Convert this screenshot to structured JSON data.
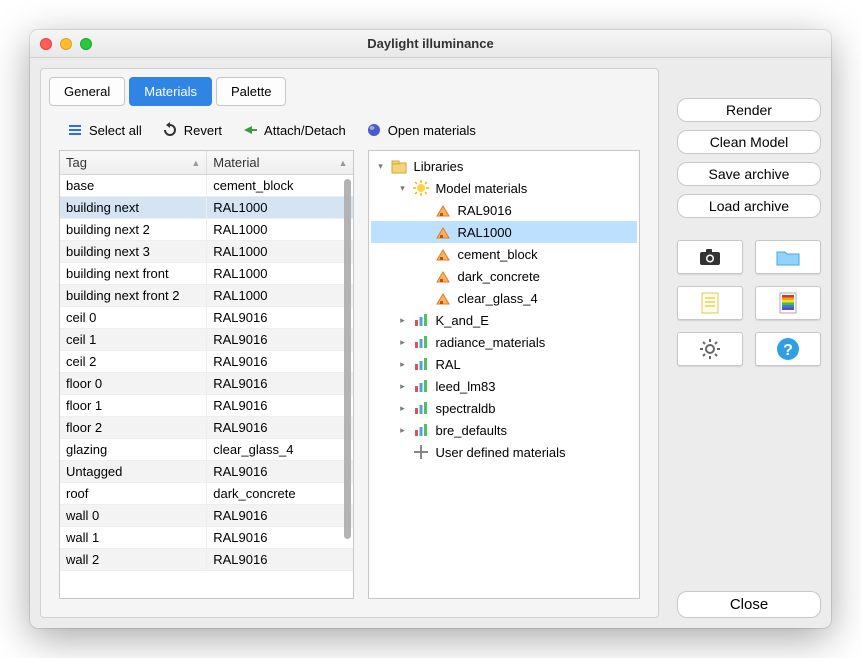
{
  "window": {
    "title": "Daylight illuminance"
  },
  "tabs": [
    {
      "label": "General",
      "active": false
    },
    {
      "label": "Materials",
      "active": true
    },
    {
      "label": "Palette",
      "active": false
    }
  ],
  "toolbar": {
    "select_all": "Select all",
    "revert": "Revert",
    "attach_detach": "Attach/Detach",
    "open_materials": "Open materials"
  },
  "table": {
    "headers": [
      "Tag",
      "Material"
    ],
    "rows": [
      {
        "tag": "base",
        "material": "cement_block"
      },
      {
        "tag": "building next",
        "material": "RAL1000",
        "selected": true
      },
      {
        "tag": "building next 2",
        "material": "RAL1000"
      },
      {
        "tag": "building next 3",
        "material": "RAL1000"
      },
      {
        "tag": "building next front",
        "material": "RAL1000"
      },
      {
        "tag": "building next front 2",
        "material": "RAL1000"
      },
      {
        "tag": "ceil 0",
        "material": "RAL9016"
      },
      {
        "tag": "ceil 1",
        "material": "RAL9016"
      },
      {
        "tag": "ceil 2",
        "material": "RAL9016"
      },
      {
        "tag": "floor 0",
        "material": "RAL9016"
      },
      {
        "tag": "floor 1",
        "material": "RAL9016"
      },
      {
        "tag": "floor 2",
        "material": "RAL9016"
      },
      {
        "tag": "glazing",
        "material": "clear_glass_4"
      },
      {
        "tag": "Untagged",
        "material": "RAL9016"
      },
      {
        "tag": "roof",
        "material": "dark_concrete"
      },
      {
        "tag": "wall 0",
        "material": "RAL9016"
      },
      {
        "tag": "wall 1",
        "material": "RAL9016"
      },
      {
        "tag": "wall 2",
        "material": "RAL9016"
      }
    ]
  },
  "tree": {
    "root": {
      "label": "Libraries",
      "expanded": true,
      "icon": "library"
    },
    "model_materials": {
      "label": "Model materials",
      "expanded": true,
      "icon": "model",
      "children": [
        {
          "label": "RAL9016",
          "icon": "material"
        },
        {
          "label": "RAL1000",
          "icon": "material",
          "selected": true
        },
        {
          "label": "cement_block",
          "icon": "material"
        },
        {
          "label": "dark_concrete",
          "icon": "material"
        },
        {
          "label": "clear_glass_4",
          "icon": "material"
        }
      ]
    },
    "libraries": [
      {
        "label": "K_and_E",
        "icon": "chart"
      },
      {
        "label": "radiance_materials",
        "icon": "chart"
      },
      {
        "label": "RAL",
        "icon": "chart"
      },
      {
        "label": "leed_lm83",
        "icon": "chart"
      },
      {
        "label": "spectraldb",
        "icon": "chart"
      },
      {
        "label": "bre_defaults",
        "icon": "chart"
      },
      {
        "label": "User defined materials",
        "icon": "tools"
      }
    ]
  },
  "sidebar": {
    "render": "Render",
    "clean_model": "Clean Model",
    "save_archive": "Save archive",
    "load_archive": "Load archive",
    "close": "Close"
  }
}
